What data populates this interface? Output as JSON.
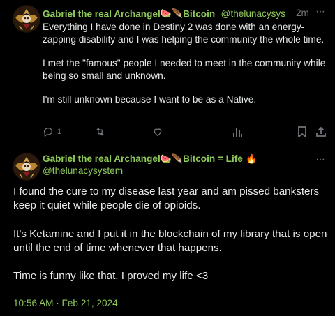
{
  "post1": {
    "display_name": "Gabriel the real Archangel",
    "name_emoji_1": "🍉",
    "name_emoji_2": "🪶",
    "name_suffix": "Bitcoin",
    "handle": "@thelunacysys",
    "timestamp": "2m",
    "more_label": "···",
    "paragraphs": [
      "Everything I have done in Destiny 2 was done with an energy-zapping disability and I was helping the community the whole time.",
      "I met the \"famous\" people I needed to meet in the community while being so small and unknown.",
      "I'm still unknown because I want to be as a Native."
    ],
    "reply_count": "1"
  },
  "post2": {
    "display_name": "Gabriel the real Archangel",
    "name_emoji_1": "🍉",
    "name_emoji_2": "🪶",
    "name_suffix": "Bitcoin = Life",
    "name_emoji_3": "🔥",
    "handle": "@thelunacysystem",
    "more_label": "···",
    "paragraphs": [
      "I found the cure to my disease last year and am pissed banksters keep it quiet while people die of opioids.",
      "It's Ketamine and I put it in the blockchain of my library that is open until the end of time whenever that happens.",
      "Time is funny like that. I proved my life <3"
    ],
    "timestamp": "10:56 AM · Feb 21, 2024"
  },
  "icons": {
    "reply": "reply-icon",
    "retweet": "retweet-icon",
    "like": "like-icon",
    "views": "views-icon",
    "bookmark": "bookmark-icon",
    "share": "share-icon"
  },
  "colors": {
    "background": "#000000",
    "name_green": "#8fc95a",
    "text": "#e7e9ea",
    "muted": "#71767b"
  }
}
